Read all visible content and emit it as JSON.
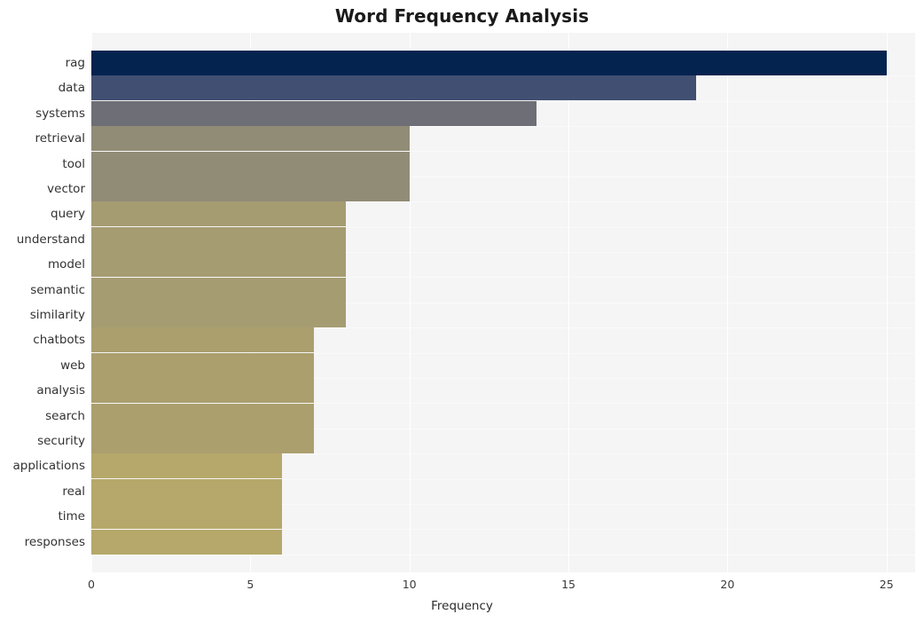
{
  "chart_data": {
    "type": "bar",
    "orientation": "horizontal",
    "title": "Word Frequency Analysis",
    "xlabel": "Frequency",
    "ylabel": "",
    "xlim": [
      0,
      25.9
    ],
    "xticks": [
      0,
      5,
      10,
      15,
      20,
      25
    ],
    "xtick_labels": [
      "0",
      "5",
      "10",
      "15",
      "20",
      "25"
    ],
    "grid": true,
    "grid_color": "#ffffff",
    "plot_background": "#f5f5f5",
    "figure_background": "#ffffff",
    "legend": false,
    "categories": [
      "rag",
      "data",
      "systems",
      "retrieval",
      "tool",
      "vector",
      "query",
      "understand",
      "model",
      "semantic",
      "similarity",
      "chatbots",
      "web",
      "analysis",
      "search",
      "security",
      "applications",
      "real",
      "time",
      "responses"
    ],
    "values": [
      25,
      19,
      14,
      10,
      10,
      10,
      8,
      8,
      8,
      8,
      8,
      7,
      7,
      7,
      7,
      7,
      6,
      6,
      6,
      6
    ],
    "bar_colors": [
      "#04234f",
      "#414f72",
      "#6d6e76",
      "#918c76",
      "#918c76",
      "#918c76",
      "#a69c72",
      "#a69c72",
      "#a69c72",
      "#a69c72",
      "#a69c72",
      "#ab9f6e",
      "#ab9f6e",
      "#ab9f6e",
      "#ab9f6e",
      "#ab9f6e",
      "#b6a86a",
      "#b6a86a",
      "#b6a86a",
      "#b6a86a"
    ]
  },
  "colors": {
    "accent_dark": "#04234f",
    "accent_light": "#b6a86a",
    "text": "#333333",
    "title_text": "#1a1a1a"
  }
}
